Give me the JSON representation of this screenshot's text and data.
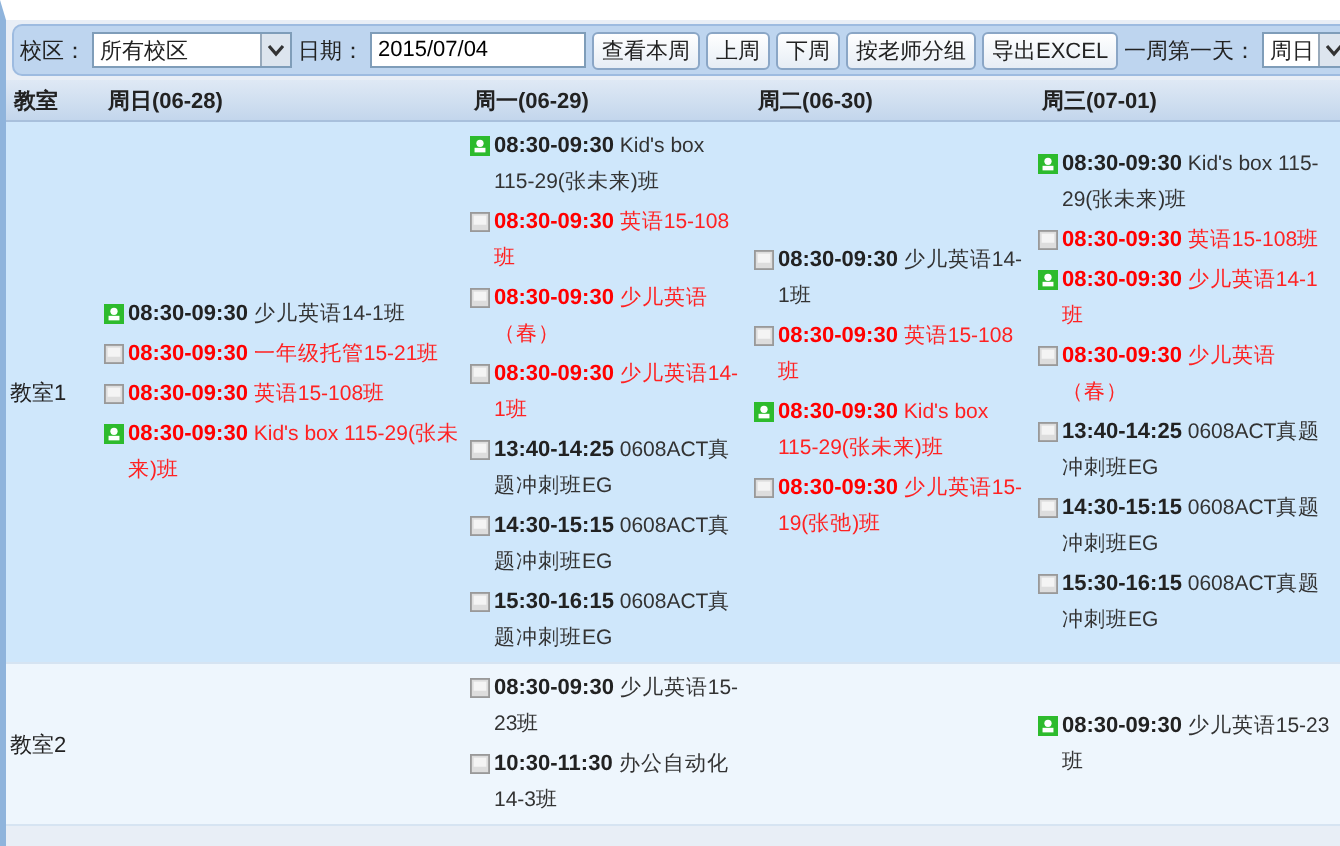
{
  "toolbar": {
    "campus_label": "校区：",
    "campus": "所有校区",
    "date_label": "日期：",
    "date": "2015/07/04",
    "buttons": [
      "查看本周",
      "上周",
      "下周",
      "按老师分组",
      "导出EXCEL"
    ],
    "first_day_label": "一周第一天：",
    "first_day": "周日"
  },
  "table": {
    "columns": [
      "教室",
      "周日(06-28)",
      "周一(06-29)",
      "周二(06-30)",
      "周三(07-01)"
    ],
    "rows": [
      {
        "room": "教室1",
        "sunday": [
          {
            "kind": "green",
            "conflict": false,
            "time": "08:30-09:30",
            "name": "少儿英语14-1班"
          },
          {
            "kind": "gray",
            "conflict": true,
            "time": "08:30-09:30",
            "name": "一年级托管15-21班"
          },
          {
            "kind": "gray",
            "conflict": true,
            "time": "08:30-09:30",
            "name": "英语15-108班"
          },
          {
            "kind": "green",
            "conflict": true,
            "time": "08:30-09:30",
            "name": "Kid's box 115-29(张未来)班"
          }
        ],
        "monday": [
          {
            "kind": "green",
            "conflict": false,
            "time": "08:30-09:30",
            "name": "Kid's box 115-29(张未来)班"
          },
          {
            "kind": "gray",
            "conflict": true,
            "time": "08:30-09:30",
            "name": "英语15-108班"
          },
          {
            "kind": "gray",
            "conflict": true,
            "time": "08:30-09:30",
            "name": "少儿英语（春）"
          },
          {
            "kind": "gray",
            "conflict": true,
            "time": "08:30-09:30",
            "name": "少儿英语14-1班"
          },
          {
            "kind": "gray",
            "conflict": false,
            "time": "13:40-14:25",
            "name": "0608ACT真题冲刺班EG"
          },
          {
            "kind": "gray",
            "conflict": false,
            "time": "14:30-15:15",
            "name": "0608ACT真题冲刺班EG"
          },
          {
            "kind": "gray",
            "conflict": false,
            "time": "15:30-16:15",
            "name": "0608ACT真题冲刺班EG"
          }
        ],
        "tuesday": [
          {
            "kind": "gray",
            "conflict": false,
            "time": "08:30-09:30",
            "name": "少儿英语14-1班"
          },
          {
            "kind": "gray",
            "conflict": true,
            "time": "08:30-09:30",
            "name": "英语15-108班"
          },
          {
            "kind": "green",
            "conflict": true,
            "time": "08:30-09:30",
            "name": "Kid's box 115-29(张未来)班"
          },
          {
            "kind": "gray",
            "conflict": true,
            "time": "08:30-09:30",
            "name": "少儿英语15-19(张弛)班"
          }
        ],
        "wednesday": [
          {
            "kind": "green",
            "conflict": false,
            "time": "08:30-09:30",
            "name": "Kid's box 115-29(张未来)班"
          },
          {
            "kind": "gray",
            "conflict": true,
            "time": "08:30-09:30",
            "name": "英语15-108班"
          },
          {
            "kind": "green",
            "conflict": true,
            "time": "08:30-09:30",
            "name": "少儿英语14-1班"
          },
          {
            "kind": "gray",
            "conflict": true,
            "time": "08:30-09:30",
            "name": "少儿英语（春）"
          },
          {
            "kind": "gray",
            "conflict": false,
            "time": "13:40-14:25",
            "name": "0608ACT真题冲刺班EG"
          },
          {
            "kind": "gray",
            "conflict": false,
            "time": "14:30-15:15",
            "name": "0608ACT真题冲刺班EG"
          },
          {
            "kind": "gray",
            "conflict": false,
            "time": "15:30-16:15",
            "name": "0608ACT真题冲刺班EG"
          }
        ]
      },
      {
        "room": "教室2",
        "monday": [
          {
            "kind": "gray",
            "conflict": false,
            "time": "08:30-09:30",
            "name": "少儿英语15-23班"
          },
          {
            "kind": "gray",
            "conflict": false,
            "time": "10:30-11:30",
            "name": "办公自动化14-3班"
          }
        ],
        "wednesday": [
          {
            "kind": "green",
            "conflict": false,
            "time": "08:30-09:30",
            "name": "少儿英语15-23班"
          }
        ]
      }
    ]
  }
}
